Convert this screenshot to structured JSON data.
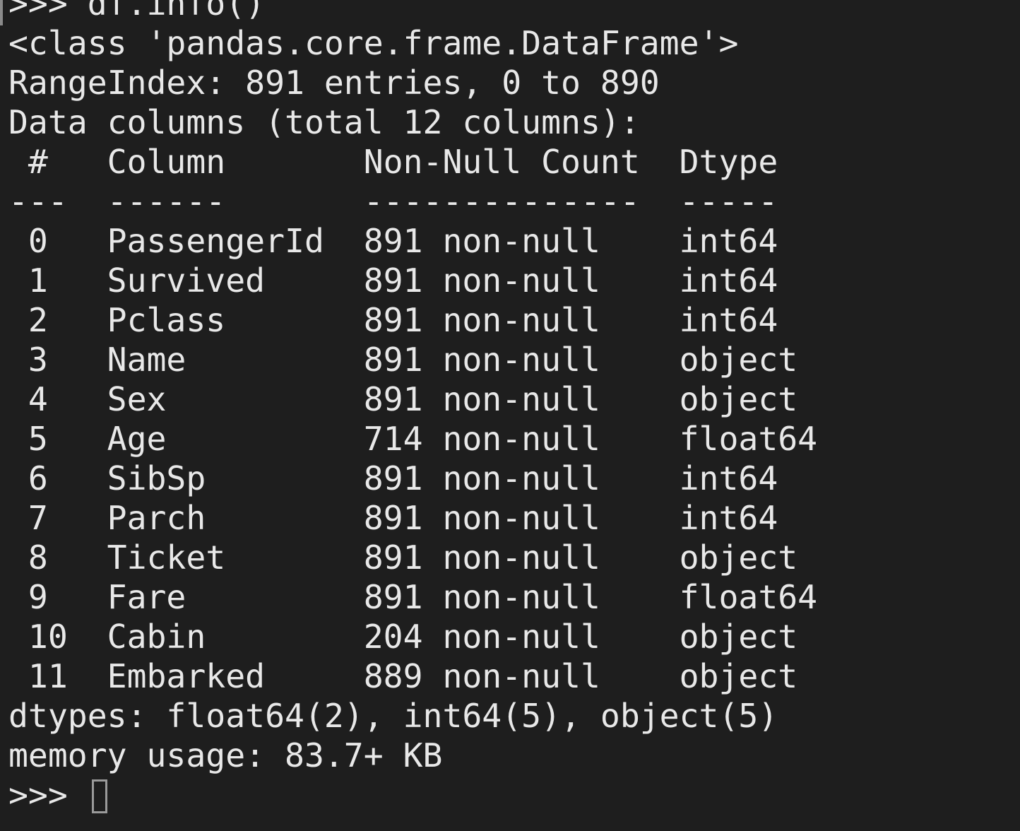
{
  "terminal": {
    "command_line": ">>> df.info()",
    "class_line": "<class 'pandas.core.frame.DataFrame'>",
    "range_index_line": "RangeIndex: 891 entries, 0 to 890",
    "data_columns_line": "Data columns (total 12 columns):",
    "header_line": " #   Column       Non-Null Count  Dtype  ",
    "separator_line": "---  ------       --------------  -----  ",
    "rows": [
      " 0   PassengerId  891 non-null    int64  ",
      " 1   Survived     891 non-null    int64  ",
      " 2   Pclass       891 non-null    int64  ",
      " 3   Name         891 non-null    object ",
      " 4   Sex          891 non-null    object ",
      " 5   Age          714 non-null    float64",
      " 6   SibSp        891 non-null    int64  ",
      " 7   Parch        891 non-null    int64  ",
      " 8   Ticket       891 non-null    object ",
      " 9   Fare         891 non-null    float64",
      " 10  Cabin        204 non-null    object ",
      " 11  Embarked     889 non-null    object "
    ],
    "dtypes_line": "dtypes: float64(2), int64(5), object(5)",
    "memory_line": "memory usage: 83.7+ KB",
    "prompt": ">>> "
  },
  "colors": {
    "background": "#1e1e1e",
    "foreground": "#e8e8e8",
    "cursor": "#9a9a9a"
  }
}
